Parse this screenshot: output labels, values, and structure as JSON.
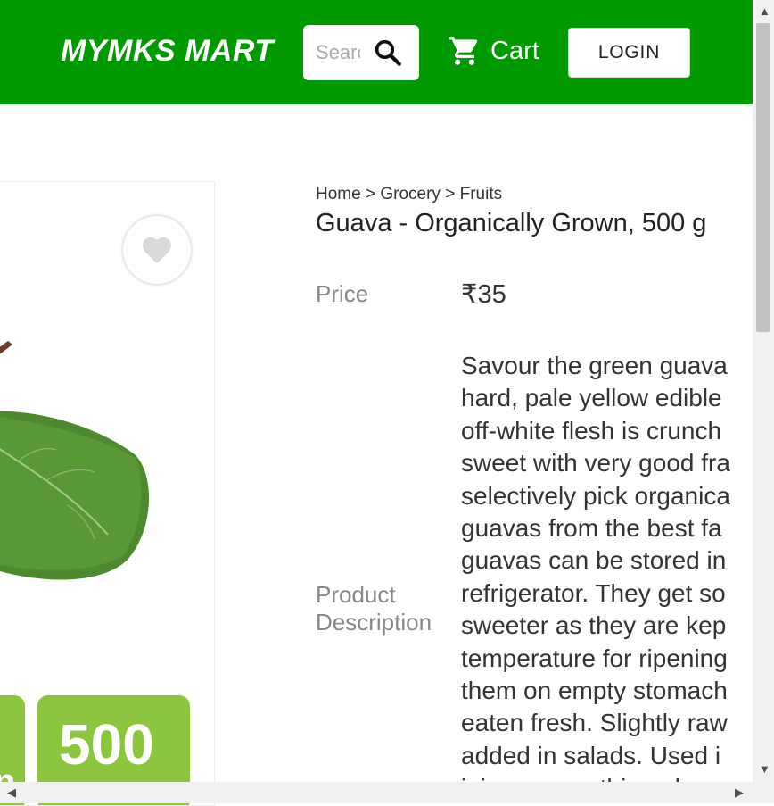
{
  "header": {
    "brand": "MYMKS MART",
    "search_placeholder": "Search",
    "cart_label": "Cart",
    "login_label": "LOGIN"
  },
  "breadcrumb": [
    "Home",
    "Grocery",
    "Fruits"
  ],
  "breadcrumb_separator": ">",
  "product": {
    "title": "Guava - Organically Grown, 500 g",
    "price_label": "Price",
    "price": "₹35",
    "description_label": "Product Description",
    "description_lines": [
      "Savour the green guava",
      "hard, pale yellow edible",
      "off-white flesh is crunch",
      "sweet with very good fra",
      "selectively pick organica",
      "guavas from the best fa",
      "guavas can be stored in",
      "refrigerator. They get so",
      "sweeter as they are kep",
      "temperature for ripening",
      "them on empty stomach",
      "eaten fresh. Slightly raw",
      "added in salads. Used i",
      "juices, smoothies, desse"
    ],
    "badge_text": "500"
  },
  "colors": {
    "header_bg": "#009900",
    "badge_green": "#8cc63f",
    "leaf_green": "#4a8a2e"
  }
}
